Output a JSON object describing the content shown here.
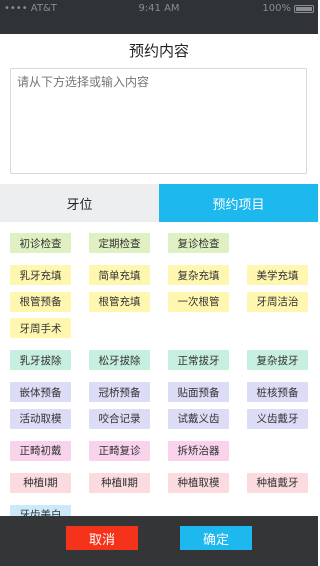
{
  "status": {
    "carrier": "•••• AT&T",
    "time": "9:41 AM",
    "battery": "100%"
  },
  "sheet": {
    "title": "预约内容",
    "placeholder": "请从下方选择或输入内容"
  },
  "tabs": [
    {
      "label": "牙位",
      "active": false
    },
    {
      "label": "预约项目",
      "active": true
    }
  ],
  "tag_groups": [
    {
      "color": "#dff0c2",
      "rows": [
        [
          "初诊检查",
          "定期检查",
          "复诊检查"
        ]
      ]
    },
    {
      "color": "#fff6b0",
      "rows": [
        [
          "乳牙充填",
          "简单充填",
          "复杂充填",
          "美学充填"
        ],
        [
          "根管预备",
          "根管充填",
          "一次根管",
          "牙周洁治"
        ],
        [
          "牙周手术"
        ]
      ]
    },
    {
      "color": "#c7efe0",
      "rows": [
        [
          "乳牙拔除",
          "松牙拔除",
          "正常拔牙",
          "复杂拔牙"
        ]
      ]
    },
    {
      "color": "#dcdcf7",
      "rows": [
        [
          "嵌体预备",
          "冠桥预备",
          "贴面预备",
          "桩核预备"
        ],
        [
          "活动取模",
          "咬合记录",
          "试戴义齿",
          "义齿戴牙"
        ]
      ]
    },
    {
      "color": "#f9d3ec",
      "rows": [
        [
          "正畸初戴",
          "正畸复诊",
          "拆矫治器"
        ]
      ]
    },
    {
      "color": "#fbdbde",
      "rows": [
        [
          "种植Ⅰ期",
          "种植Ⅱ期",
          "种植取模",
          "种植戴牙"
        ]
      ]
    },
    {
      "color": "#cbe9f9",
      "rows": [
        [
          "牙齿美白"
        ]
      ]
    }
  ],
  "actions": {
    "cancel": "取消",
    "confirm": "确定"
  }
}
